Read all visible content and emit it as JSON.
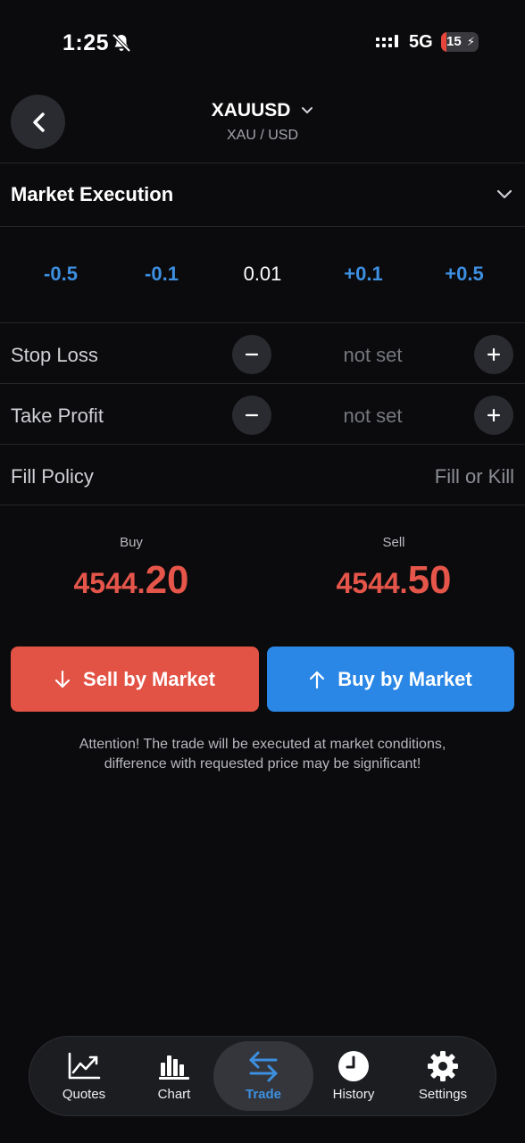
{
  "status": {
    "time": "1:25",
    "network": "5G",
    "battery": "15",
    "battery_level": 0.15
  },
  "header": {
    "symbol": "XAUUSD",
    "pair": "XAU / USD"
  },
  "execution": {
    "label": "Market Execution"
  },
  "volume": {
    "dec_large": "-0.5",
    "dec_small": "-0.1",
    "value": "0.01",
    "inc_small": "+0.1",
    "inc_large": "+0.5"
  },
  "stop_loss": {
    "label": "Stop Loss",
    "value": "not set"
  },
  "take_profit": {
    "label": "Take Profit",
    "value": "not set"
  },
  "fill_policy": {
    "label": "Fill Policy",
    "value": "Fill or Kill"
  },
  "quotes": {
    "buy": {
      "label": "Buy",
      "price_main": "4544.",
      "price_pips": "20"
    },
    "sell": {
      "label": "Sell",
      "price_main": "4544.",
      "price_pips": "50"
    }
  },
  "actions": {
    "sell_label": "Sell by Market",
    "buy_label": "Buy by Market"
  },
  "attention": {
    "line1": "Attention! The trade will be executed at market conditions,",
    "line2": "difference with requested price may be significant!"
  },
  "nav": {
    "quotes": "Quotes",
    "chart": "Chart",
    "trade": "Trade",
    "history": "History",
    "settings": "Settings"
  },
  "colors": {
    "sell": "#e25245",
    "buy": "#2a87e6",
    "accent": "#3d8fe0",
    "price": "#e5554a",
    "background": "#0b0b0d"
  }
}
